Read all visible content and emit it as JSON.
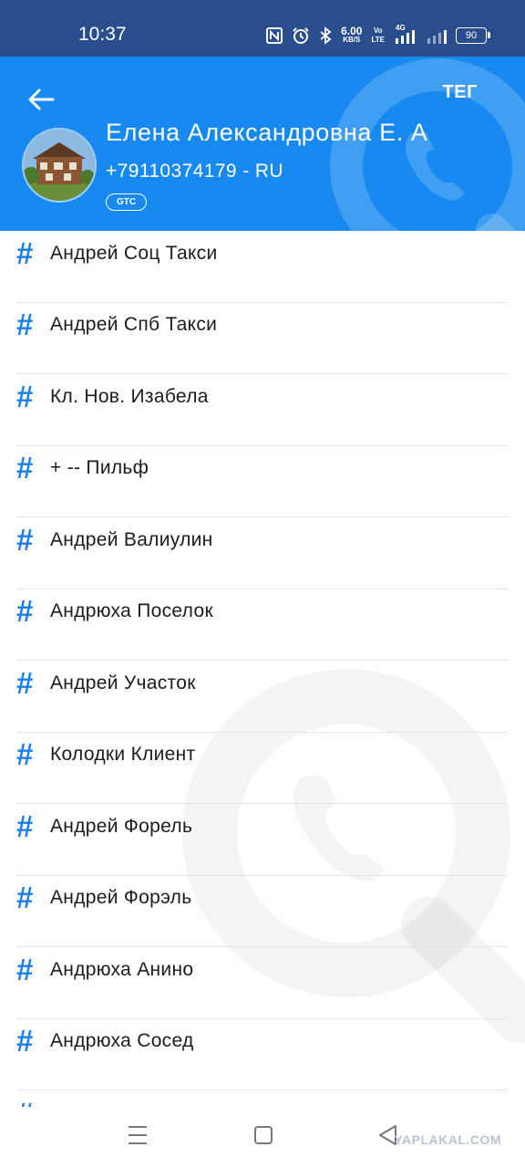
{
  "status_bar": {
    "time": "10:37",
    "net_speed_value": "6.00",
    "net_speed_unit": "KB/S",
    "volte_top": "Vo",
    "volte_bottom": "LTE",
    "network": "4G",
    "battery": "90",
    "icons": [
      "nfc-icon",
      "alarm-icon",
      "bluetooth-icon",
      "signal-icon",
      "signal-2-icon",
      "battery-icon"
    ]
  },
  "header": {
    "back_icon": "back-arrow-icon",
    "tag_button": "ТЕГ",
    "contact_name": "Елена Александровна Е. А",
    "phone": "+79110374179 - RU",
    "operator_badge": "GTC",
    "background_color": "#1789f1"
  },
  "tags": [
    {
      "label": "Андрей Соц Такси"
    },
    {
      "label": "Андрей Спб Такси"
    },
    {
      "label": "Кл. Нов. Изабела"
    },
    {
      "label": "+ -- Пильф"
    },
    {
      "label": "Андрей Валиулин"
    },
    {
      "label": "Андрюха Поселок"
    },
    {
      "label": "Андрей Участок"
    },
    {
      "label": "Колодки Клиент"
    },
    {
      "label": "Андрей Форель"
    },
    {
      "label": "Андрей Форэль"
    },
    {
      "label": "Андрюха Анино"
    },
    {
      "label": "Андрюха Сосед"
    }
  ],
  "tag_symbol": "#",
  "nav_bar": {
    "buttons": [
      "menu-icon",
      "home-icon",
      "back-triangle-icon"
    ]
  },
  "watermark": "YAPLAKAL.COM"
}
